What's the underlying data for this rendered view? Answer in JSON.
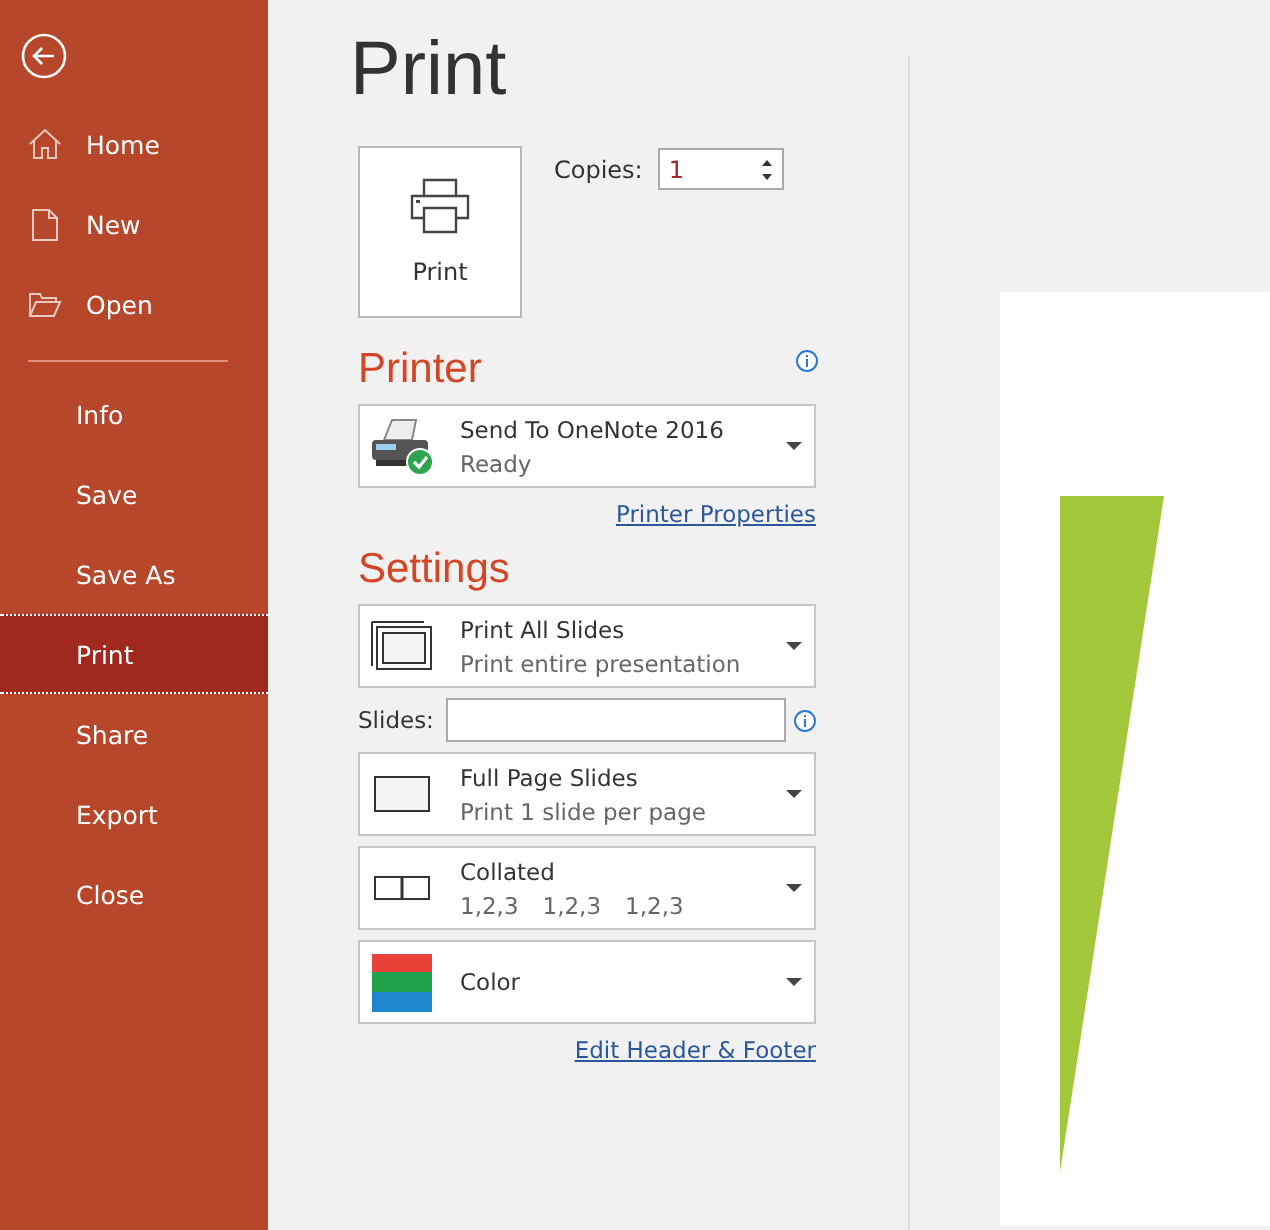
{
  "sidebar": {
    "top_items": [
      {
        "label": "Home",
        "selected": false
      },
      {
        "label": "New",
        "selected": false
      },
      {
        "label": "Open",
        "selected": false
      }
    ],
    "items": [
      {
        "label": "Info",
        "selected": false
      },
      {
        "label": "Save",
        "selected": false
      },
      {
        "label": "Save As",
        "selected": false
      },
      {
        "label": "Print",
        "selected": true
      },
      {
        "label": "Share",
        "selected": false
      },
      {
        "label": "Export",
        "selected": false
      },
      {
        "label": "Close",
        "selected": false
      }
    ]
  },
  "title": "Print",
  "print_button": {
    "label": "Print"
  },
  "copies": {
    "label": "Copies:",
    "value": "1"
  },
  "printer": {
    "heading": "Printer",
    "name": "Send To OneNote 2016",
    "status": "Ready",
    "link": "Printer Properties"
  },
  "settings": {
    "heading": "Settings",
    "rows": [
      {
        "kind": "slides",
        "title": "Print All Slides",
        "subtitle": [
          "Print entire presentation"
        ]
      },
      {
        "kind": "field",
        "label": "Slides:"
      },
      {
        "kind": "layout",
        "title": "Full Page Slides",
        "subtitle": [
          "Print 1 slide per page"
        ]
      },
      {
        "kind": "collate",
        "title": "Collated",
        "subtitle": [
          "1,2,3",
          "1,2,3",
          "1,2,3"
        ]
      },
      {
        "kind": "color",
        "title": "Color"
      }
    ],
    "link": "Edit Header & Footer"
  }
}
